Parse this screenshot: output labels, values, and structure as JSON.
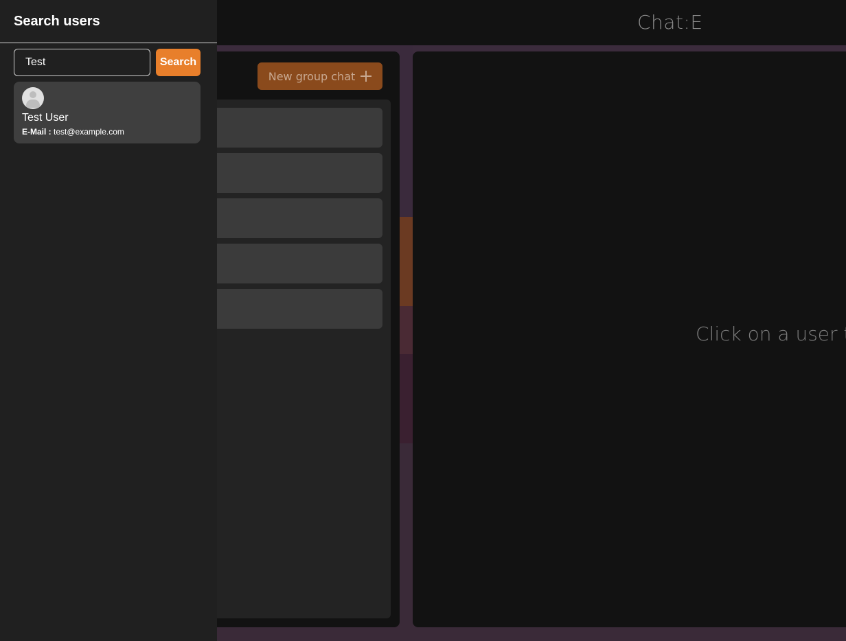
{
  "app": {
    "title": "Chat:E",
    "new_group_label": "New group chat",
    "placeholder": "Click on a user t"
  },
  "drawer": {
    "title": "Search users",
    "search_value": "Test",
    "search_button": "Search",
    "results": [
      {
        "name": "Test User",
        "email_label": "E-Mail :",
        "email": "test@example.com"
      }
    ]
  },
  "colors": {
    "accent": "#e87f2b",
    "drawer_bg": "#202020",
    "card_bg": "#3f3f3f",
    "panel_bg": "#121212"
  },
  "icons": {
    "new_group": "plus-icon",
    "avatar": "user-avatar-icon"
  }
}
